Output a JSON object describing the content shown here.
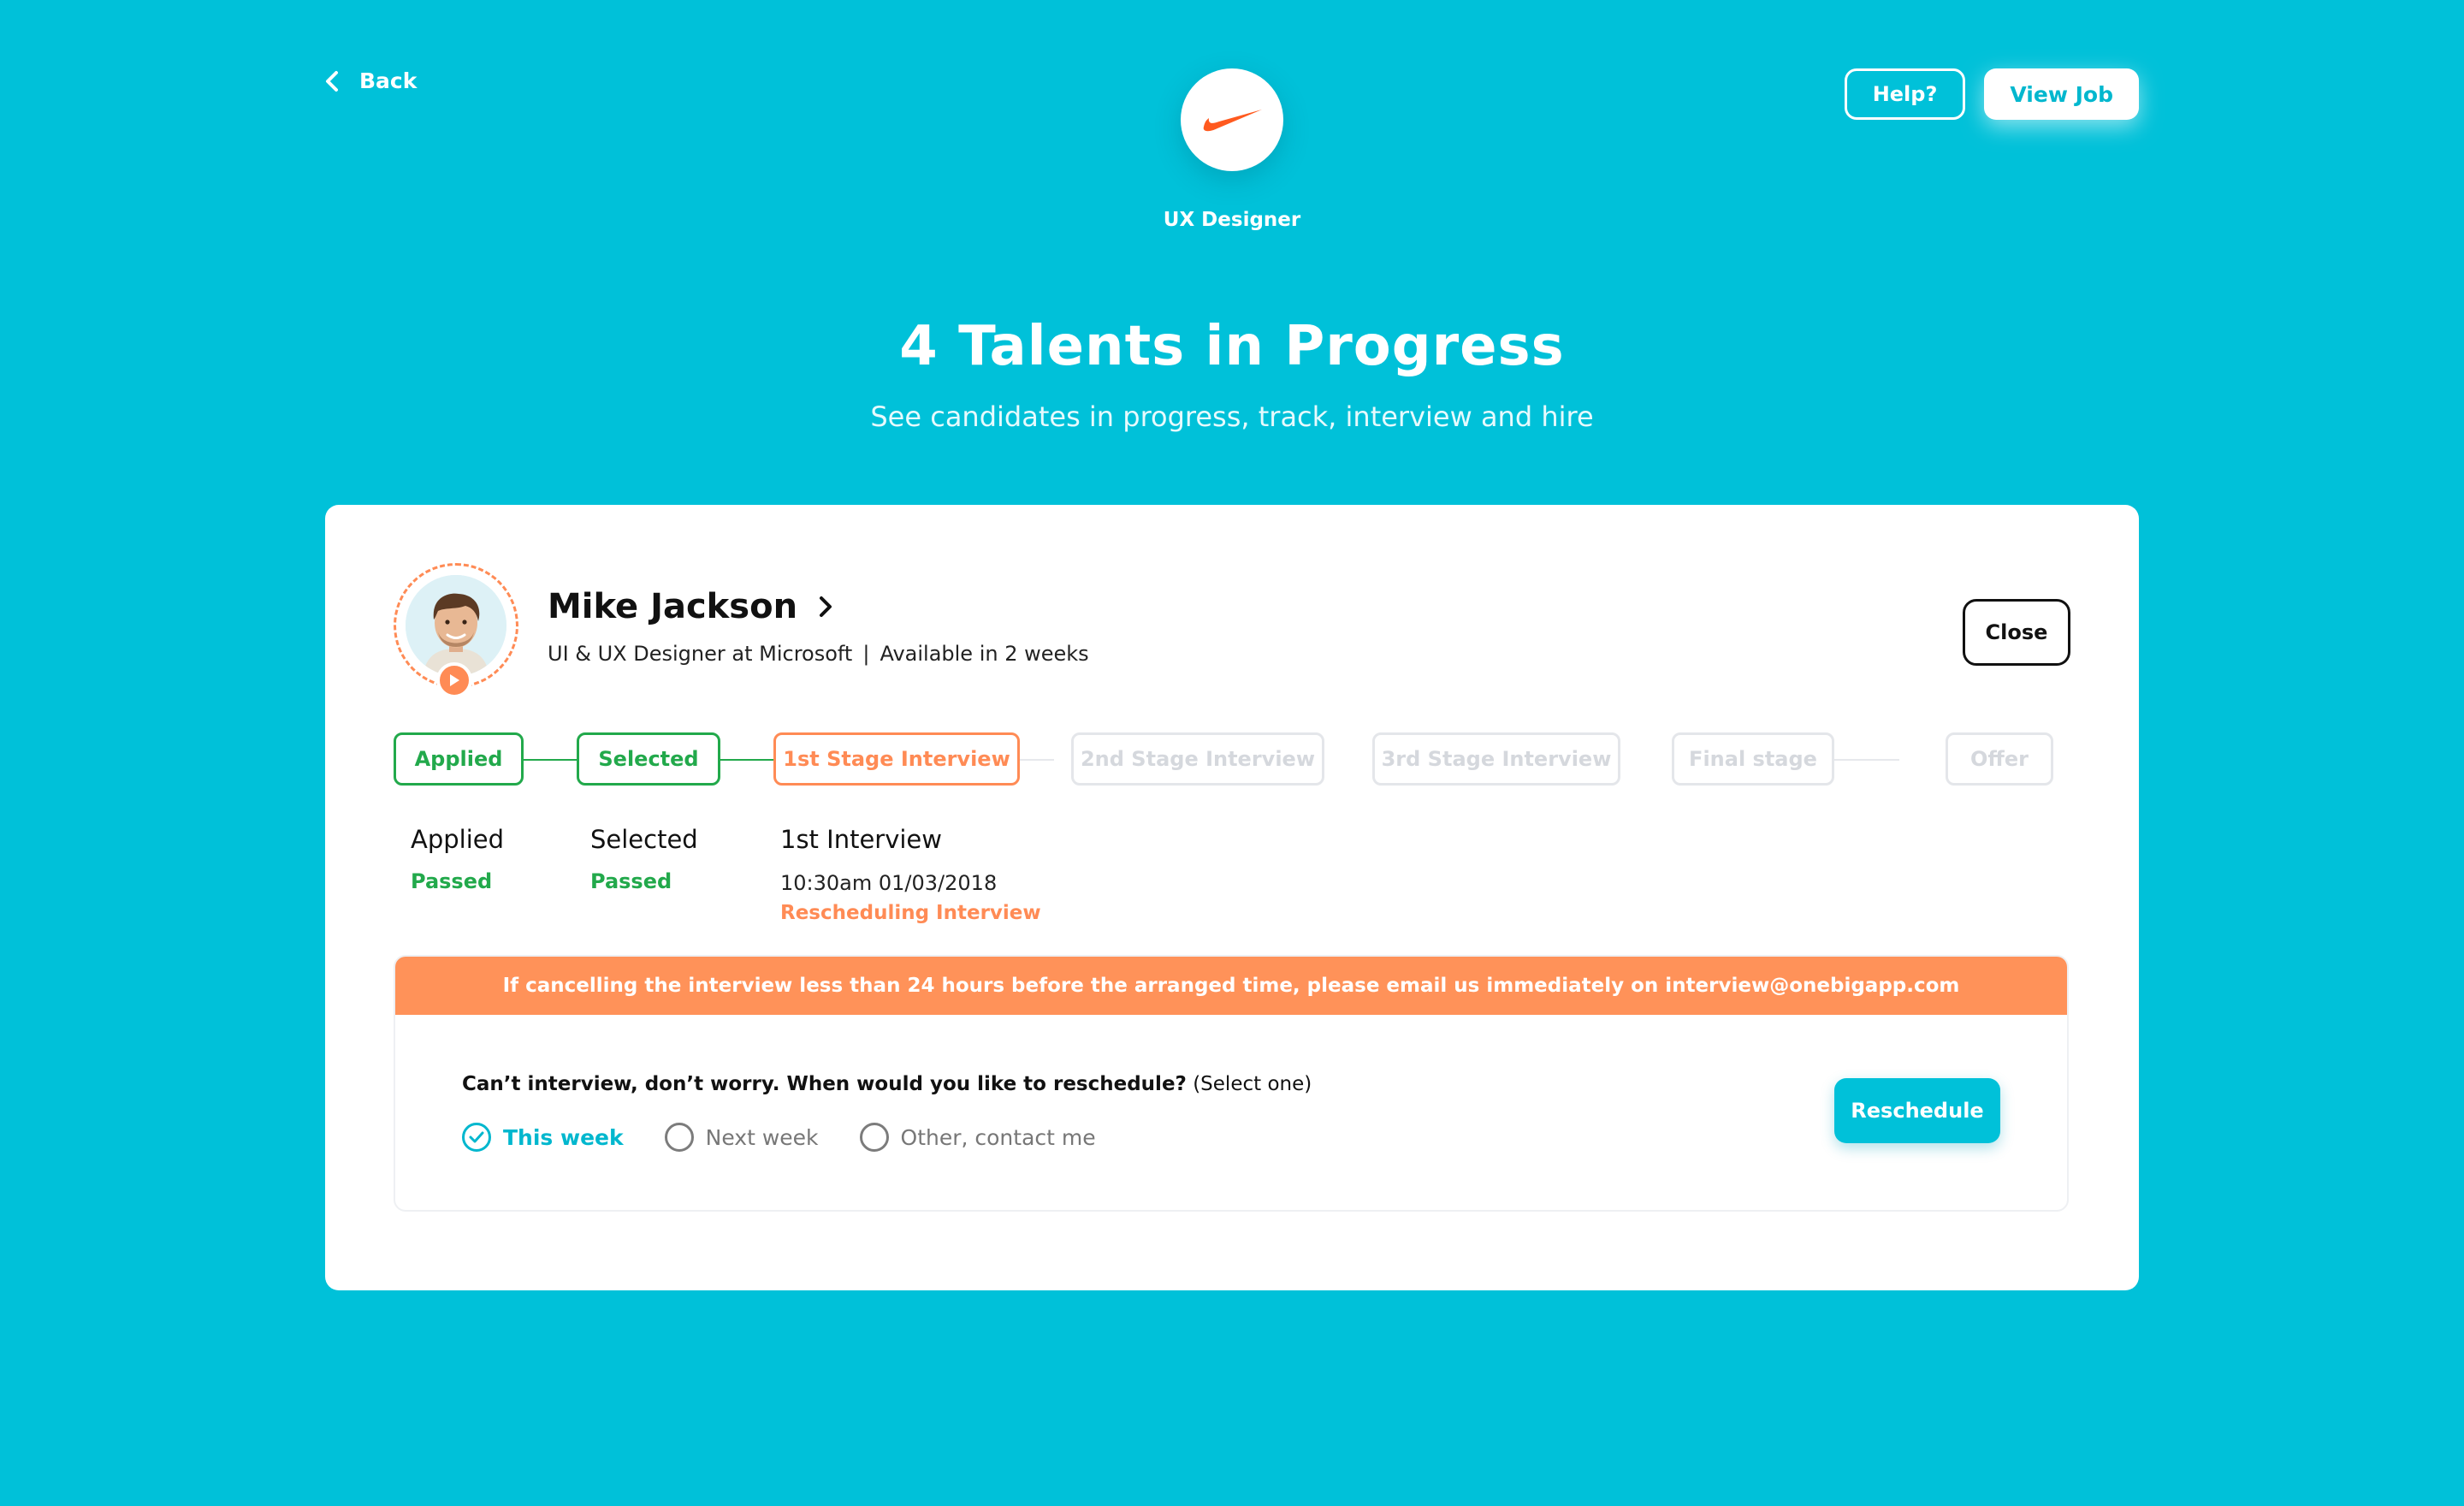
{
  "nav": {
    "back_label": "Back"
  },
  "job": {
    "title": "UX Designer",
    "logo": "swoosh-logo"
  },
  "actions": {
    "help_label": "Help?",
    "view_job_label": "View Job"
  },
  "hero": {
    "title": "4 Talents in Progress",
    "subtitle": "See candidates in progress, track, interview and hire"
  },
  "candidate": {
    "name": "Mike Jackson",
    "role": "UI & UX Designer at Microsoft",
    "separator": "|",
    "availability": "Available in 2 weeks",
    "close_label": "Close"
  },
  "stages": [
    {
      "label": "Applied",
      "state": "passed"
    },
    {
      "label": "Selected",
      "state": "passed"
    },
    {
      "label": "1st Stage Interview",
      "state": "current"
    },
    {
      "label": "2nd Stage Interview",
      "state": "upcoming"
    },
    {
      "label": "3rd Stage Interview",
      "state": "upcoming"
    },
    {
      "label": "Final stage",
      "state": "upcoming"
    },
    {
      "label": "Offer",
      "state": "upcoming"
    }
  ],
  "details": {
    "applied": {
      "title": "Applied",
      "status": "Passed"
    },
    "selected": {
      "title": "Selected",
      "status": "Passed"
    },
    "interview": {
      "title": "1st Interview",
      "time": "10:30am 01/03/2018",
      "note": "Rescheduling Interview"
    }
  },
  "reschedule": {
    "banner": "If cancelling the interview less than 24 hours before the arranged time, please email us immediately on interview@onebigapp.com",
    "question_bold": "Can’t interview, don’t worry. When would you like to reschedule?",
    "question_hint": "(Select one)",
    "options": [
      {
        "label": "This week",
        "selected": true
      },
      {
        "label": "Next week",
        "selected": false
      },
      {
        "label": "Other, contact me",
        "selected": false
      }
    ],
    "button_label": "Reschedule"
  },
  "colors": {
    "background": "#00C1D9",
    "passed": "#22A94B",
    "current": "#FF8B55",
    "banner": "#FF9259",
    "accent": "#00B7CE"
  }
}
